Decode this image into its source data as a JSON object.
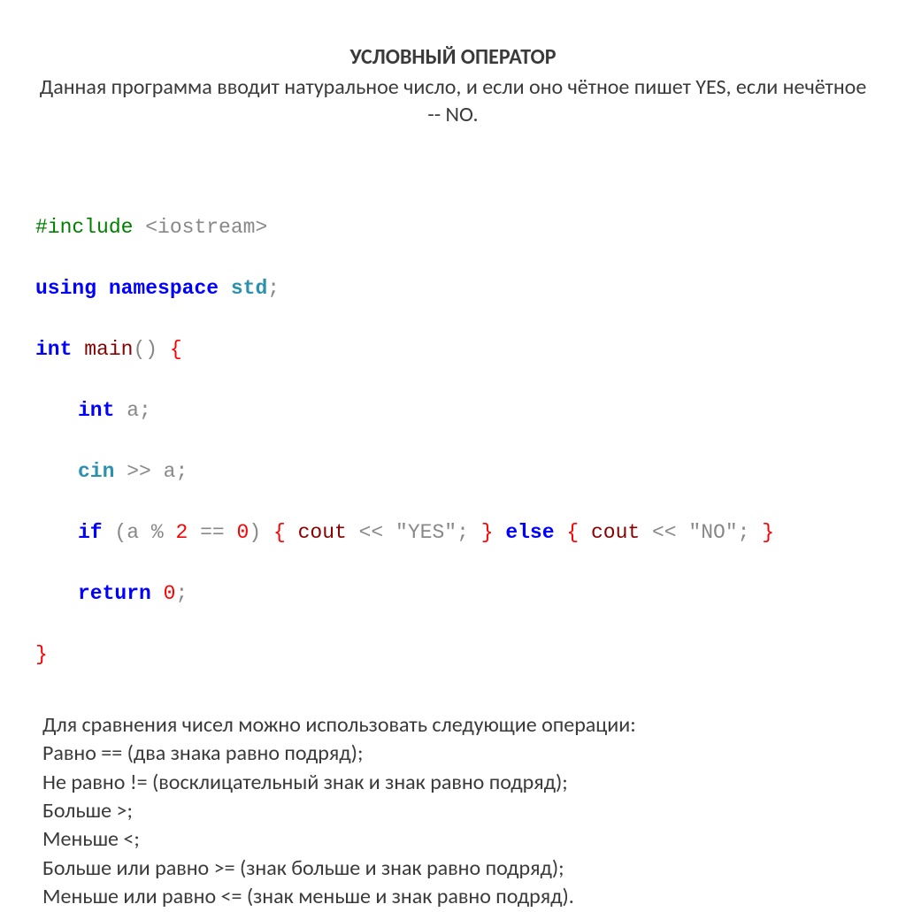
{
  "header": {
    "title": "УСЛОВНЫЙ ОПЕРАТОР",
    "subtitle": "Данная программа вводит натуральное число, и если оно чётное пишет YES, если нечётное -- NO."
  },
  "code": {
    "line1_include": "#include",
    "line1_header": "<iostream>",
    "line2_using": "using",
    "line2_namespace": "namespace",
    "line2_std": "std",
    "line3_int": "int",
    "line3_main": "main",
    "line3_parens": "()",
    "line4_int": "int",
    "line4_var": "a",
    "line5_cin": "cin",
    "line5_op": ">>",
    "line5_var": "a",
    "line6_if": "if",
    "line6_expr_a": "a",
    "line6_expr_mod": "%",
    "line6_expr_2": "2",
    "line6_expr_eq": "==",
    "line6_expr_0": "0",
    "line6_cout1": "cout",
    "line6_op1": "<<",
    "line6_str1": "\"YES\"",
    "line6_else": "else",
    "line6_cout2": "cout",
    "line6_op2": "<<",
    "line6_str2": "\"NO\"",
    "line7_return": "return",
    "line7_0": "0"
  },
  "explanation": {
    "intro": "Для сравнения чисел можно использовать следующие операции:",
    "op1": "Равно == (два знака равно подряд);",
    "op2": "Не равно != (восклицательный знак и знак равно подряд);",
    "op3": "Больше >;",
    "op4": "Меньше <;",
    "op5": "Больше или равно >= (знак больше и знак равно подряд);",
    "op6": "Меньше или равно <= (знак меньше и знак равно подряд)."
  }
}
